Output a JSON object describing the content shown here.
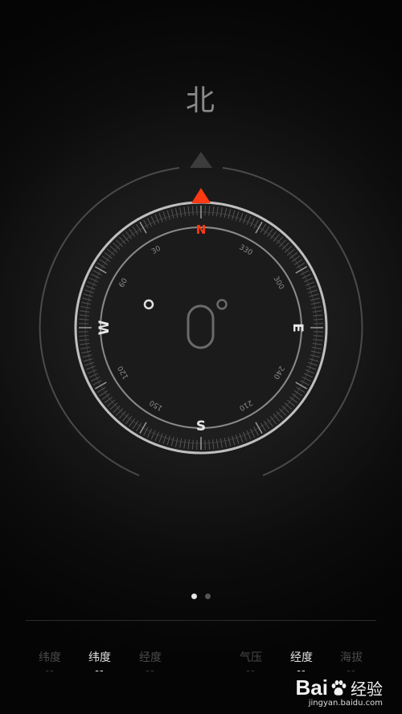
{
  "heading": {
    "direction": "北"
  },
  "compass": {
    "accent_color": "#ff3a12",
    "cardinals": {
      "north": "N",
      "east": "E",
      "south": "S",
      "west": "W"
    },
    "degree_labels": [
      "30",
      "60",
      "120",
      "150",
      "210",
      "240",
      "300",
      "330"
    ],
    "center_reading": "0°",
    "north_triangle_color": "#ff3a12",
    "reference_triangle_color": "#3c3c3c"
  },
  "pager": {
    "pages": 2,
    "current": 1
  },
  "info_bar": {
    "left": [
      {
        "label": "纬度",
        "value": "--",
        "active": false
      },
      {
        "label": "纬度",
        "value": "--",
        "active": true
      },
      {
        "label": "经度",
        "value": "--",
        "active": false
      }
    ],
    "right": [
      {
        "label": "气压",
        "value": "--",
        "active": false
      },
      {
        "label": "经度",
        "value": "--",
        "active": true
      },
      {
        "label": "海拔",
        "value": "--",
        "active": false
      }
    ]
  },
  "watermark": {
    "brand": "Bai",
    "brand_cn": "经验",
    "url": "jingyan.baidu.com"
  }
}
